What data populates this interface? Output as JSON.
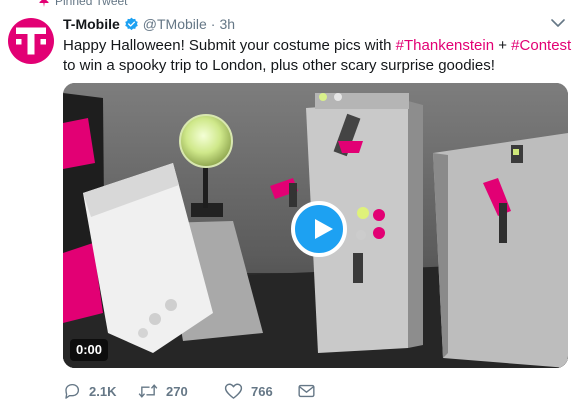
{
  "pinned_label": "Pinned Tweet",
  "tweet": {
    "author_name": "T-Mobile",
    "handle": "@TMobile",
    "separator": "·",
    "time": "3h",
    "text": {
      "t1": "Happy Halloween! Submit your costume pics with ",
      "h1": "#Thankenstein",
      "t2": " + ",
      "h2": "#Contest",
      "t3": " to win a spooky trip to London, plus other scary surprise goodies!"
    }
  },
  "media": {
    "duration": "0:00"
  },
  "actions": {
    "replies": "2.1K",
    "retweets": "270",
    "likes": "766"
  },
  "colors": {
    "brand": "#e20074",
    "accent": "#1da1f2",
    "muted": "#657786"
  },
  "icons": {
    "pin": "pin-icon",
    "verified": "verified-badge-icon",
    "caret": "chevron-down-icon",
    "play": "play-icon",
    "reply": "reply-icon",
    "retweet": "retweet-icon",
    "like": "heart-icon",
    "dm": "envelope-icon"
  }
}
